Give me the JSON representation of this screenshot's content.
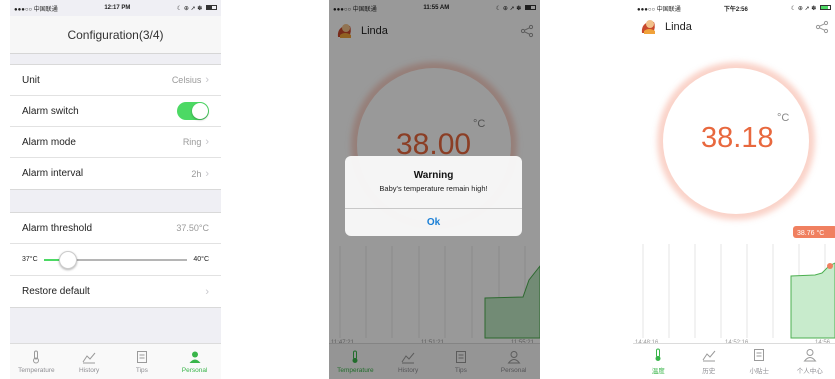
{
  "screen1": {
    "status": {
      "carrier": "●●●○○ 中国联通",
      "time": "12:17 PM"
    },
    "title": "Configuration(3/4)",
    "rows": {
      "unit": {
        "label": "Unit",
        "value": "Celsius"
      },
      "alarm_switch": {
        "label": "Alarm switch",
        "on": true
      },
      "alarm_mode": {
        "label": "Alarm mode",
        "value": "Ring"
      },
      "alarm_interval": {
        "label": "Alarm interval",
        "value": "2h"
      },
      "alarm_threshold": {
        "label": "Alarm threshold",
        "value": "37.50°C"
      },
      "slider": {
        "min": "37°C",
        "max": "40°C",
        "level": 0.17
      },
      "restore": {
        "label": "Restore default"
      }
    },
    "tabs": [
      {
        "label": "Temperature"
      },
      {
        "label": "History"
      },
      {
        "label": "Tips"
      },
      {
        "label": "Personal"
      }
    ]
  },
  "screen2": {
    "status": {
      "carrier": "●●●○○ 中国联通",
      "time": "11:55 AM"
    },
    "user": "Linda",
    "temp": "38.00",
    "unit": "°C",
    "alert": {
      "title": "Warning",
      "message": "Baby's temperature remain high!",
      "button": "Ok"
    },
    "chart_times": [
      "11:47:21",
      "11:51:21",
      "11:55:21"
    ],
    "tabs": [
      {
        "label": "Temperature"
      },
      {
        "label": "History"
      },
      {
        "label": "Tips"
      },
      {
        "label": "Personal"
      }
    ]
  },
  "screen3": {
    "status": {
      "carrier": "●●●○○ 中国联通",
      "time": "下午2:56"
    },
    "user": "Linda",
    "temp": "38.18",
    "unit": "°C",
    "bubble": "38.76 °C",
    "chart_times": [
      "14:48:16",
      "14:52:16",
      "14:56"
    ],
    "tabs": [
      {
        "label": "温度"
      },
      {
        "label": "历史"
      },
      {
        "label": "小贴士"
      },
      {
        "label": "个人中心"
      }
    ]
  },
  "colors": {
    "accent": "#39b54a",
    "temp": "#e8683e",
    "link": "#1a7fd6"
  }
}
